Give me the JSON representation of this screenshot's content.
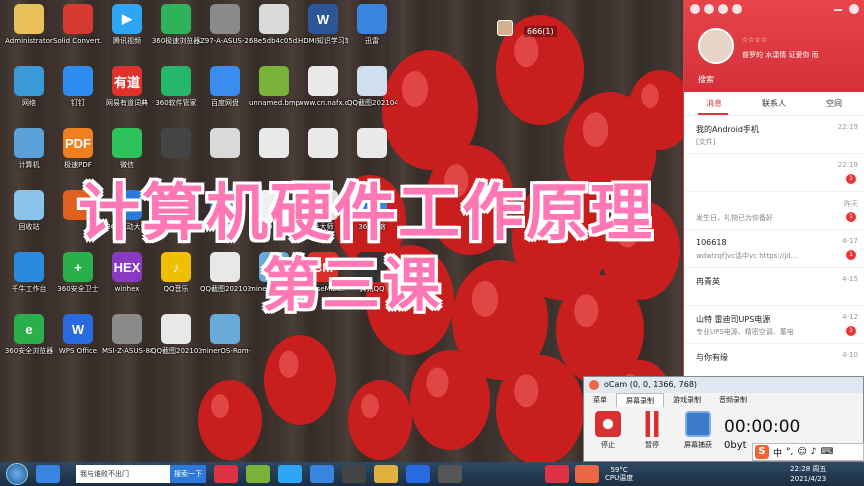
{
  "overlay": {
    "title_main": "计算机硬件工作原理",
    "title_sub": "第三课"
  },
  "zoom_readout": "666(1)",
  "desktop_icons": [
    {
      "label": "Administrator",
      "color": "#e9c15a",
      "glyph": ""
    },
    {
      "label": "Solid Convert...",
      "color": "#d43a2f",
      "glyph": ""
    },
    {
      "label": "腾讯视频",
      "color": "#2ea6f5",
      "glyph": "▶"
    },
    {
      "label": "360极速浏览器",
      "color": "#2fb25a",
      "glyph": ""
    },
    {
      "label": "Z97-A-ASUS-2205.CAP",
      "color": "#8a8a8a",
      "glyph": ""
    },
    {
      "label": "68e5db4c05d3ce1418...",
      "color": "#d9d9d9",
      "glyph": ""
    },
    {
      "label": "HDMI知识学习笔记.docx",
      "color": "#2b5797",
      "glyph": "W"
    },
    {
      "label": "迅雷",
      "color": "#3a85e0",
      "glyph": ""
    },
    {
      "label": "网络",
      "color": "#3a9ad9",
      "glyph": ""
    },
    {
      "label": "钉钉",
      "color": "#2d8cf0",
      "glyph": ""
    },
    {
      "label": "网易有道词典",
      "color": "#e0322a",
      "glyph": "有道"
    },
    {
      "label": "360软件管家",
      "color": "#26b86a",
      "glyph": ""
    },
    {
      "label": "百度网盘",
      "color": "#3a8cf0",
      "glyph": ""
    },
    {
      "label": "unnamed.bmp",
      "color": "#7ab33a",
      "glyph": ""
    },
    {
      "label": "www.cn.nafx.com迅捷...",
      "color": "#e9e9e9",
      "glyph": ""
    },
    {
      "label": "QQ截图20210422...",
      "color": "#cfdff0",
      "glyph": ""
    },
    {
      "label": "计算机",
      "color": "#5ba0d9",
      "glyph": ""
    },
    {
      "label": "极速PDF",
      "color": "#f07f1e",
      "glyph": "PDF"
    },
    {
      "label": "微信",
      "color": "#2ec25a",
      "glyph": ""
    },
    {
      "label": "",
      "color": "#444444",
      "glyph": ""
    },
    {
      "label": "",
      "color": "#d9d9d9",
      "glyph": ""
    },
    {
      "label": "",
      "color": "#e9e9e9",
      "glyph": ""
    },
    {
      "label": "",
      "color": "#e9e9e9",
      "glyph": ""
    },
    {
      "label": "",
      "color": "#e9e9e9",
      "glyph": ""
    },
    {
      "label": "回收站",
      "color": "#8ac4ea",
      "glyph": ""
    },
    {
      "label": "",
      "color": "#e06020",
      "glyph": ""
    },
    {
      "label": "360驱动大师",
      "color": "#2a7ad9",
      "glyph": ""
    },
    {
      "label": "蜜蜂剪辑",
      "color": "#f0c020",
      "glyph": ""
    },
    {
      "label": "央视影音",
      "color": "#3a6ae0",
      "glyph": ""
    },
    {
      "label": "OrCAD Capture CIS...",
      "color": "#f0f0f0",
      "glyph": ""
    },
    {
      "label": "鲁大师",
      "color": "#e0e0e0",
      "glyph": ""
    },
    {
      "label": "360压缩",
      "color": "#3a85e0",
      "glyph": ""
    },
    {
      "label": "千牛工作台",
      "color": "#2a8ae0",
      "glyph": ""
    },
    {
      "label": "360安全卫士",
      "color": "#2ab04a",
      "glyph": "+"
    },
    {
      "label": "winhex",
      "color": "#8a3ac0",
      "glyph": "HEX"
    },
    {
      "label": "QQ音乐",
      "color": "#f0c000",
      "glyph": "♪"
    },
    {
      "label": "QQ截图20210326...",
      "color": "#e8e8e8",
      "glyph": ""
    },
    {
      "label": "minerOS Rom Flasher",
      "color": "#6aaad9",
      "glyph": ""
    },
    {
      "label": "CourseMaker",
      "color": "#d9302a",
      "glyph": "CM"
    },
    {
      "label": "腾讯QQ",
      "color": "#333333",
      "glyph": ""
    },
    {
      "label": "360安全浏览器",
      "color": "#2ab04a",
      "glyph": "e"
    },
    {
      "label": "WPS Office",
      "color": "#2a6ae0",
      "glyph": "W"
    },
    {
      "label": "MSI-Z-ASUS-885...",
      "color": "#8a8a8a",
      "glyph": ""
    },
    {
      "label": "QQ截图20210326...",
      "color": "#e8e8e8",
      "glyph": ""
    },
    {
      "label": "minerOS-Rom-Flasher-...",
      "color": "#6aaad9",
      "glyph": ""
    }
  ],
  "qq": {
    "status": "☆☆☆☆",
    "signature": "普罗的 水漾情 证爱你 而",
    "search": "搜索",
    "tabs": [
      "消息",
      "联系人",
      "空间"
    ],
    "conversations": [
      {
        "name": "我的Android手机",
        "msg": "[文件]",
        "time": "22:19",
        "badge": ""
      },
      {
        "name": "",
        "msg": "",
        "time": "22:19",
        "badge": "1"
      },
      {
        "name": "",
        "msg": "发生日，礼物已为你备好",
        "time": "昨天",
        "badge": "1"
      },
      {
        "name": "106618",
        "msg": "wdwtrqf]vc话中vc https://jd...",
        "time": "4-17",
        "badge": "1"
      },
      {
        "name": "冉青英",
        "msg": "",
        "time": "4-15",
        "badge": ""
      },
      {
        "name": "山特 雷迪司UPS电源",
        "msg": "专业UPS电源、精密空调、蓄电",
        "time": "4-12",
        "badge": "1"
      },
      {
        "name": "与你有缘",
        "msg": "",
        "time": "4-10",
        "badge": ""
      }
    ]
  },
  "ocam": {
    "title": "oCam (0, 0, 1366, 768)",
    "menu_tabs": [
      "菜单",
      "屏幕录制",
      "游戏录制",
      "音频录制"
    ],
    "buttons": [
      "停止",
      "暂停",
      "屏幕捕获"
    ],
    "timer": "00:00:00",
    "size": "0byt"
  },
  "ime": {
    "label": "中"
  },
  "taskbar": {
    "search_text": "我与谁败不出门",
    "search_button": "搜索一下",
    "temp": "59°C",
    "cpu_label": "CPU温度",
    "time": "22:28 周五",
    "date": "2021/4/23"
  }
}
